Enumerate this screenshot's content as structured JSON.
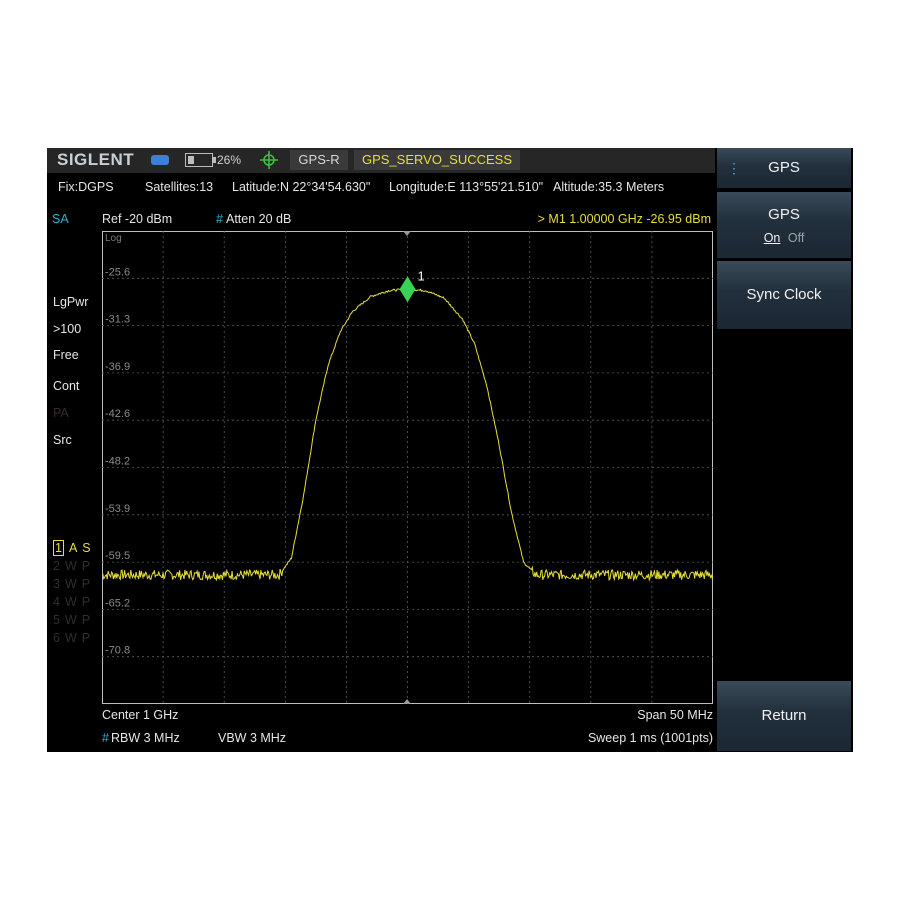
{
  "status_bar": {
    "brand": "SIGLENT",
    "battery_percent": "26%",
    "battery_level": 0.26,
    "gps_mode": "GPS-R",
    "servo_status": "GPS_SERVO_SUCCESS",
    "icons": [
      "usb-icon",
      "battery-icon",
      "gps-crosshair-icon"
    ]
  },
  "gps_info": {
    "fix": "Fix:DGPS",
    "satellites": "Satellites:13",
    "latitude": "Latitude:N 22°34'54.630\"",
    "longitude": "Longitude:E 113°55'21.510\"",
    "altitude": "Altitude:35.3 Meters"
  },
  "measure_bar": {
    "mode": "SA",
    "ref_level": "Ref  -20 dBm",
    "atten_mark": "#",
    "atten": "Atten  20 dB",
    "marker_readout": ">  M1   1.00000 GHz  -26.95 dBm"
  },
  "left_panel": {
    "items": [
      "LgPwr",
      ">100",
      "Free",
      "Cont",
      "PA",
      "Src"
    ],
    "traces": [
      {
        "num": "1",
        "mode": "A",
        "det": "S",
        "active": true
      },
      {
        "num": "2",
        "mode": "W",
        "det": "P",
        "active": false
      },
      {
        "num": "3",
        "mode": "W",
        "det": "P",
        "active": false
      },
      {
        "num": "4",
        "mode": "W",
        "det": "P",
        "active": false
      },
      {
        "num": "5",
        "mode": "W",
        "det": "P",
        "active": false
      },
      {
        "num": "6",
        "mode": "W",
        "det": "P",
        "active": false
      }
    ]
  },
  "plot": {
    "scale_type": "Log",
    "y_ticks": [
      "-25.6",
      "-31.3",
      "-36.9",
      "-42.6",
      "-48.2",
      "-53.9",
      "-59.5",
      "-65.2",
      "-70.8"
    ],
    "marker_label": "1",
    "colors": {
      "trace": "#e6df3a",
      "marker": "#39d353",
      "grid": "#5a5a5a"
    }
  },
  "chart_data": {
    "type": "line",
    "x_unit": "GHz",
    "y_unit": "dBm",
    "ylim": [
      -76.4,
      -20
    ],
    "xlim": [
      0.975,
      1.025
    ],
    "series": [
      {
        "x": [
          0.975,
          0.9895,
          0.9905,
          0.9915,
          0.9925,
          0.9935,
          0.9945,
          0.9955,
          0.997,
          0.9985,
          1.0,
          1.0015,
          1.003,
          1.0045,
          1.0055,
          1.0065,
          1.0075,
          1.0085,
          1.0095,
          1.0105,
          1.025
        ],
        "y": [
          -61.0,
          -61.0,
          -59.0,
          -51.5,
          -42.5,
          -36.0,
          -32.0,
          -29.6,
          -27.8,
          -27.1,
          -26.95,
          -27.1,
          -28.0,
          -30.5,
          -33.5,
          -38.5,
          -45.5,
          -53.5,
          -59.5,
          -61.0,
          -61.0
        ]
      }
    ],
    "marker": {
      "name": "M1",
      "x": 1.0,
      "y": -26.95
    }
  },
  "bottom_bar": {
    "center": "Center  1 GHz",
    "span": "Span  50 MHz",
    "rbw_mark": "#",
    "rbw": "RBW  3 MHz",
    "vbw": "VBW  3 MHz",
    "sweep": "Sweep  1 ms (1001pts)"
  },
  "softkeys": {
    "title": "GPS",
    "gps_toggle_label": "GPS",
    "gps_on": "On",
    "gps_off": "Off",
    "sync_clock": "Sync Clock",
    "return": "Return"
  }
}
